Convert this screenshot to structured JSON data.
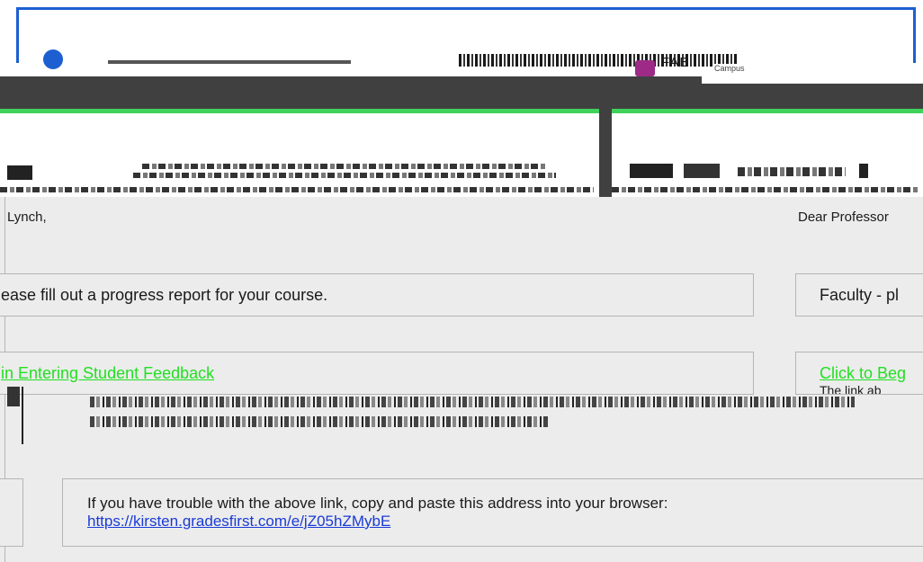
{
  "header": {
    "logo_text": "FAB",
    "logo_subtext": "Campus"
  },
  "left_column": {
    "greeting": "Lynch,",
    "instruction": "ease fill out a progress report for your course.",
    "cta_label": "in Entering Student Feedback"
  },
  "right_column": {
    "greeting": "Dear Professor",
    "instruction": "Faculty - pl",
    "cta_label": "Click to Beg",
    "note": "The link ab"
  },
  "help": {
    "text": "If you have trouble with the above link, copy and paste this address into your browser:",
    "link": "https://kirsten.gradesfirst.com/e/jZ05hZMybE"
  },
  "colors": {
    "accent_green": "#3fd25a",
    "link_green": "#22e022",
    "link_blue": "#1a3bd6",
    "nav_dark": "#404040",
    "brand_blue": "#1d5fd0",
    "logo_purple": "#9c2a86"
  }
}
